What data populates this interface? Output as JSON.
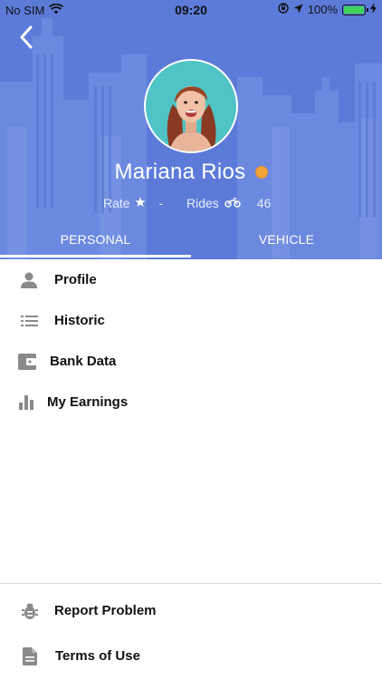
{
  "status_bar": {
    "carrier": "No SIM",
    "time": "09:20",
    "battery_percent": "100%",
    "battery_level": 1.0,
    "icons": [
      "wifi-icon",
      "orientation-lock-icon",
      "location-arrow-icon",
      "battery-icon",
      "charging-bolt-icon"
    ]
  },
  "header": {
    "back_icon": "chevron-left-icon",
    "name": "Mariana Rios",
    "status_color": "#f0a43a",
    "rate_label": "Rate",
    "rate_icon": "star-icon",
    "rate_value": "-",
    "rides_label": "Rides",
    "rides_icon": "motorcycle-icon",
    "rides_value": "46",
    "background_color": "#5c7bd9"
  },
  "tabs": [
    {
      "label": "PERSONAL",
      "active": true
    },
    {
      "label": "VEHICLE",
      "active": false
    }
  ],
  "menu": {
    "items": [
      {
        "label": "Profile",
        "icon": "person-icon"
      },
      {
        "label": "Historic",
        "icon": "list-icon"
      },
      {
        "label": "Bank Data",
        "icon": "wallet-icon"
      },
      {
        "label": "My Earnings",
        "icon": "bar-chart-icon"
      }
    ]
  },
  "footer": {
    "items": [
      {
        "label": "Report Problem",
        "icon": "bug-icon"
      },
      {
        "label": "Terms of Use",
        "icon": "document-icon"
      }
    ]
  }
}
